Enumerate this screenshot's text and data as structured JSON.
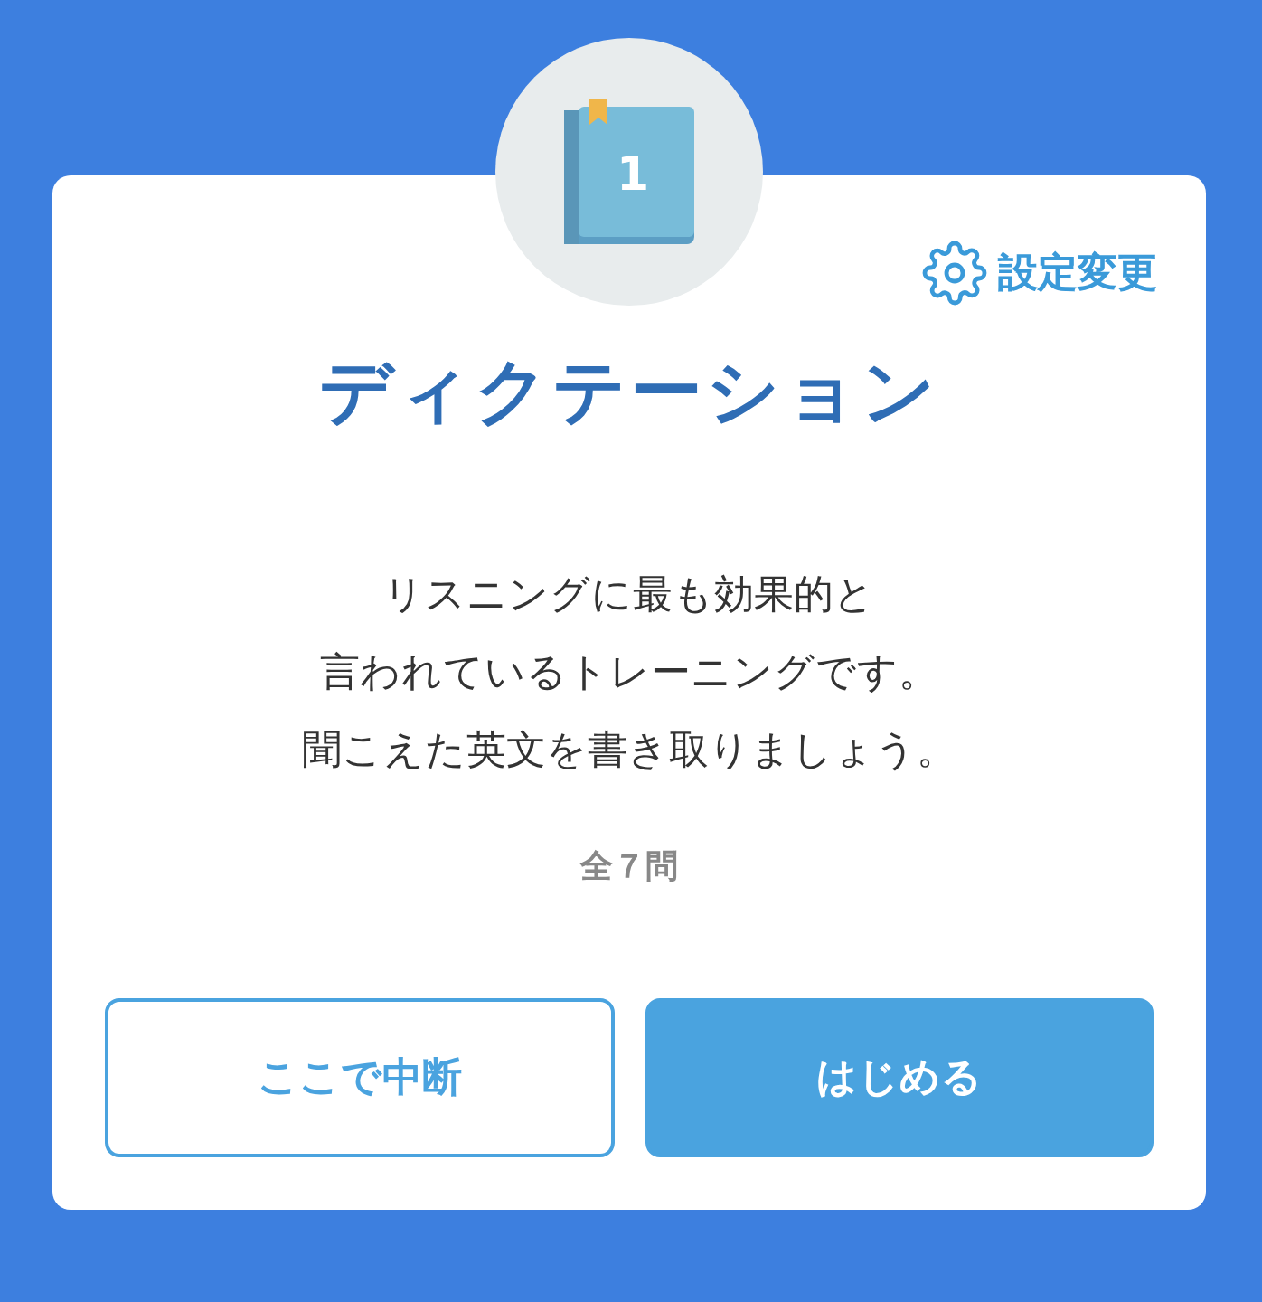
{
  "header_icon": {
    "label": "1"
  },
  "settings_link": {
    "label": "設定変更"
  },
  "title": "ディクテーション",
  "description": [
    "リスニングに最も効果的と",
    "言われているトレーニングです。",
    "聞こえた英文を書き取りましょう。"
  ],
  "question_count": "全７問",
  "buttons": [
    {
      "label": "ここで中断",
      "kind": "secondary"
    },
    {
      "label": "はじめる",
      "kind": "primary"
    }
  ]
}
